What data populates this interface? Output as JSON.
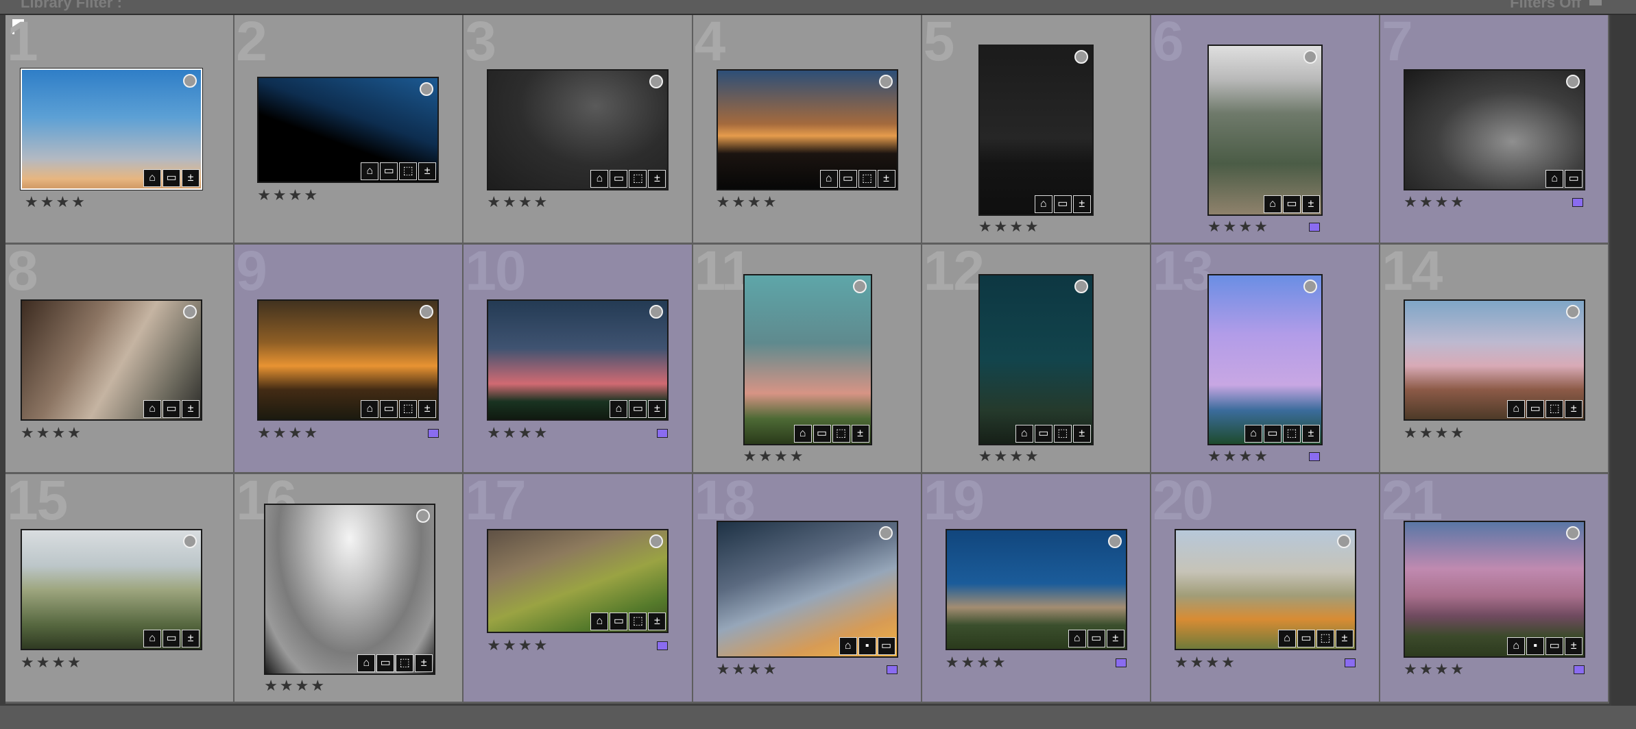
{
  "header": {
    "left_label": "Library Filter :",
    "right_label": "Filters Off"
  },
  "rating_text": "★★★★",
  "badge_glyphs": {
    "keyword": "⌂",
    "crop": "▭",
    "dev": "±",
    "collection": "⬚",
    "comment": "▪"
  },
  "label_color": "#8a6cf0",
  "cells": [
    {
      "number": "1",
      "selected": false,
      "label": false
    },
    {
      "number": "2",
      "selected": false,
      "label": false
    },
    {
      "number": "3",
      "selected": false,
      "label": false
    },
    {
      "number": "4",
      "selected": false,
      "label": false
    },
    {
      "number": "5",
      "selected": false,
      "label": false
    },
    {
      "number": "6",
      "selected": true,
      "label": true
    },
    {
      "number": "7",
      "selected": true,
      "label": true
    },
    {
      "number": "8",
      "selected": false,
      "label": false
    },
    {
      "number": "9",
      "selected": true,
      "label": true
    },
    {
      "number": "10",
      "selected": true,
      "label": true
    },
    {
      "number": "11",
      "selected": false,
      "label": false
    },
    {
      "number": "12",
      "selected": false,
      "label": false
    },
    {
      "number": "13",
      "selected": true,
      "label": true
    },
    {
      "number": "14",
      "selected": false,
      "label": false
    },
    {
      "number": "15",
      "selected": false,
      "label": false
    },
    {
      "number": "16",
      "selected": false,
      "label": false
    },
    {
      "number": "17",
      "selected": true,
      "label": true
    },
    {
      "number": "18",
      "selected": true,
      "label": true
    },
    {
      "number": "19",
      "selected": true,
      "label": true
    },
    {
      "number": "20",
      "selected": true,
      "label": true
    },
    {
      "number": "21",
      "selected": true,
      "label": true
    }
  ]
}
